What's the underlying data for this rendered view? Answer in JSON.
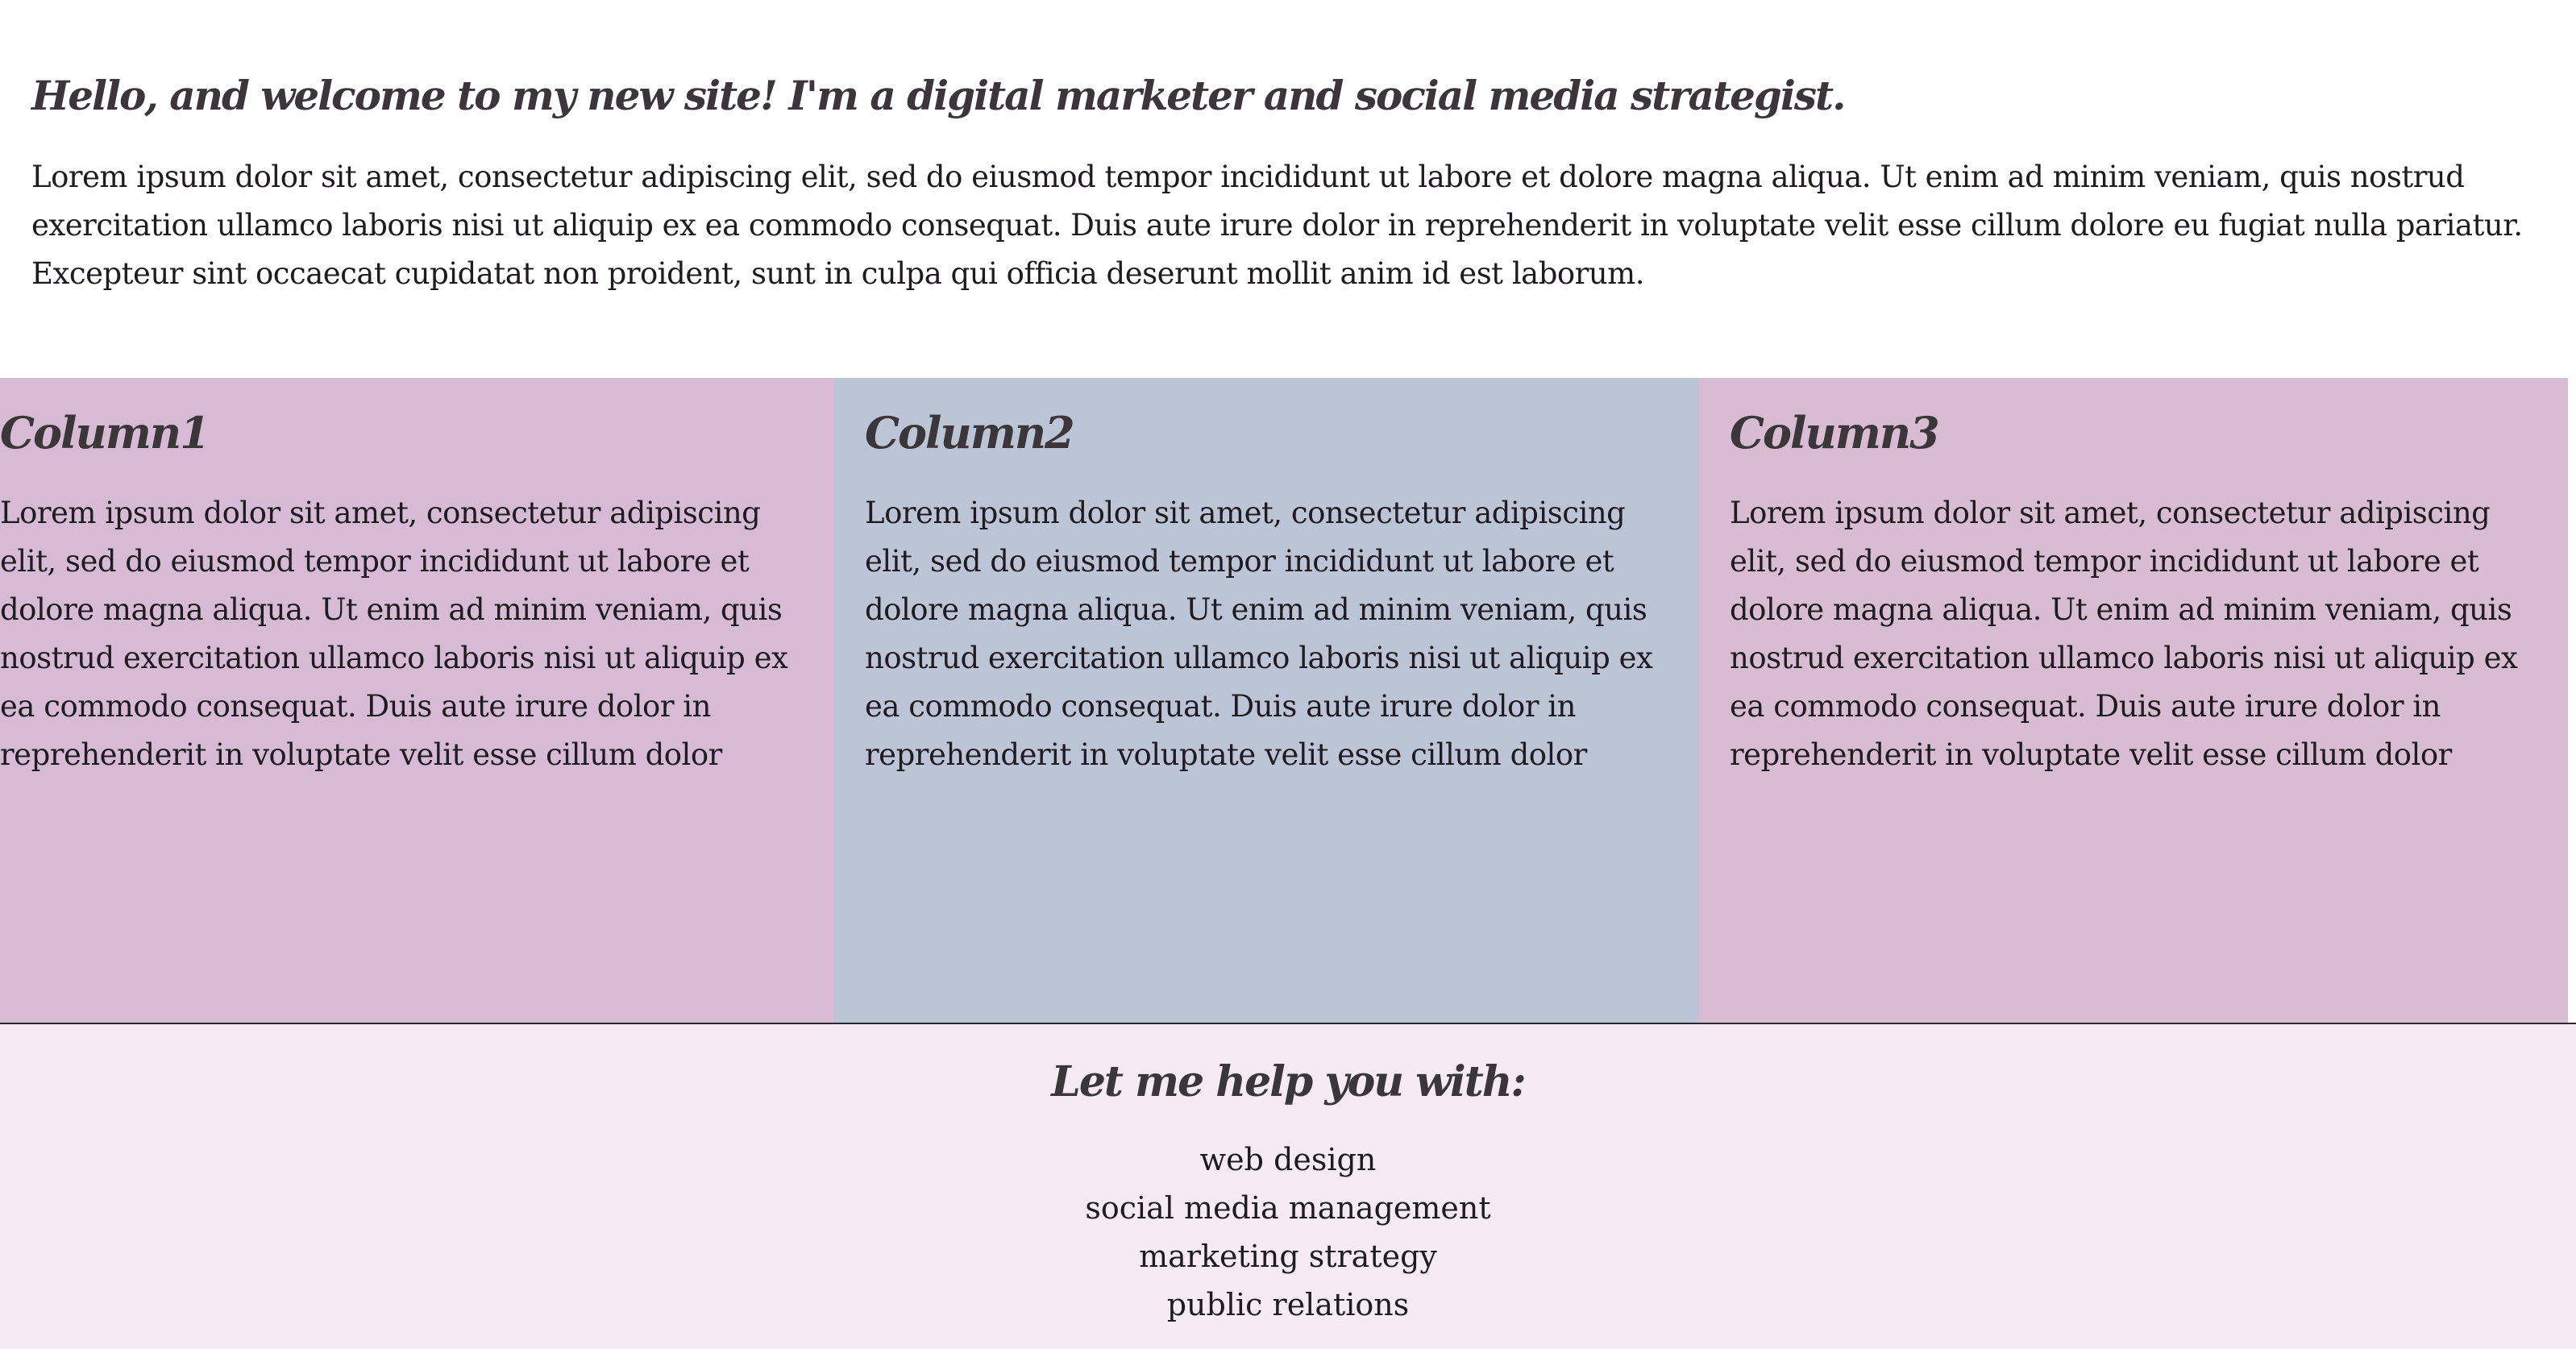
{
  "intro": {
    "heading": "Hello, and welcome to my new site! I'm a digital marketer and social media strategist.",
    "paragraph": "Lorem ipsum dolor sit amet, consectetur adipiscing elit, sed do eiusmod tempor incididunt ut labore et dolore magna aliqua. Ut enim ad minim veniam, quis nostrud exercitation ullamco laboris nisi ut aliquip ex ea commodo consequat. Duis aute irure dolor in reprehenderit in voluptate velit esse cillum dolore eu fugiat nulla pariatur. Excepteur sint occaecat cupidatat non proident, sunt in culpa qui officia deserunt mollit anim id est laborum."
  },
  "columns": [
    {
      "title": "Column1",
      "text": "Lorem ipsum dolor sit amet, consectetur adipiscing elit, sed do eiusmod tempor incididunt ut labore et dolore magna aliqua. Ut enim ad minim veniam, quis nostrud exercitation ullamco laboris nisi ut aliquip ex ea commodo consequat. Duis aute irure dolor in reprehenderit in voluptate velit esse cillum dolor",
      "color": "#d7bbd4"
    },
    {
      "title": "Column2",
      "text": "Lorem ipsum dolor sit amet, consectetur adipiscing elit, sed do eiusmod tempor incididunt ut labore et dolore magna aliqua. Ut enim ad minim veniam, quis nostrud exercitation ullamco laboris nisi ut aliquip ex ea commodo consequat. Duis aute irure dolor in reprehenderit in voluptate velit esse cillum dolor",
      "color": "#bcc5d6"
    },
    {
      "title": "Column3",
      "text": "Lorem ipsum dolor sit amet, consectetur adipiscing elit, sed do eiusmod tempor incididunt ut labore et dolore magna aliqua. Ut enim ad minim veniam, quis nostrud exercitation ullamco laboris nisi ut aliquip ex ea commodo consequat. Duis aute irure dolor in reprehenderit in voluptate velit esse cillum dolor",
      "color": "#d8bcd1"
    }
  ],
  "footer": {
    "heading": "Let me help you with:",
    "services": [
      "web design",
      "social media management",
      "marketing strategy",
      "public relations"
    ],
    "background": "#f6ebf3"
  }
}
